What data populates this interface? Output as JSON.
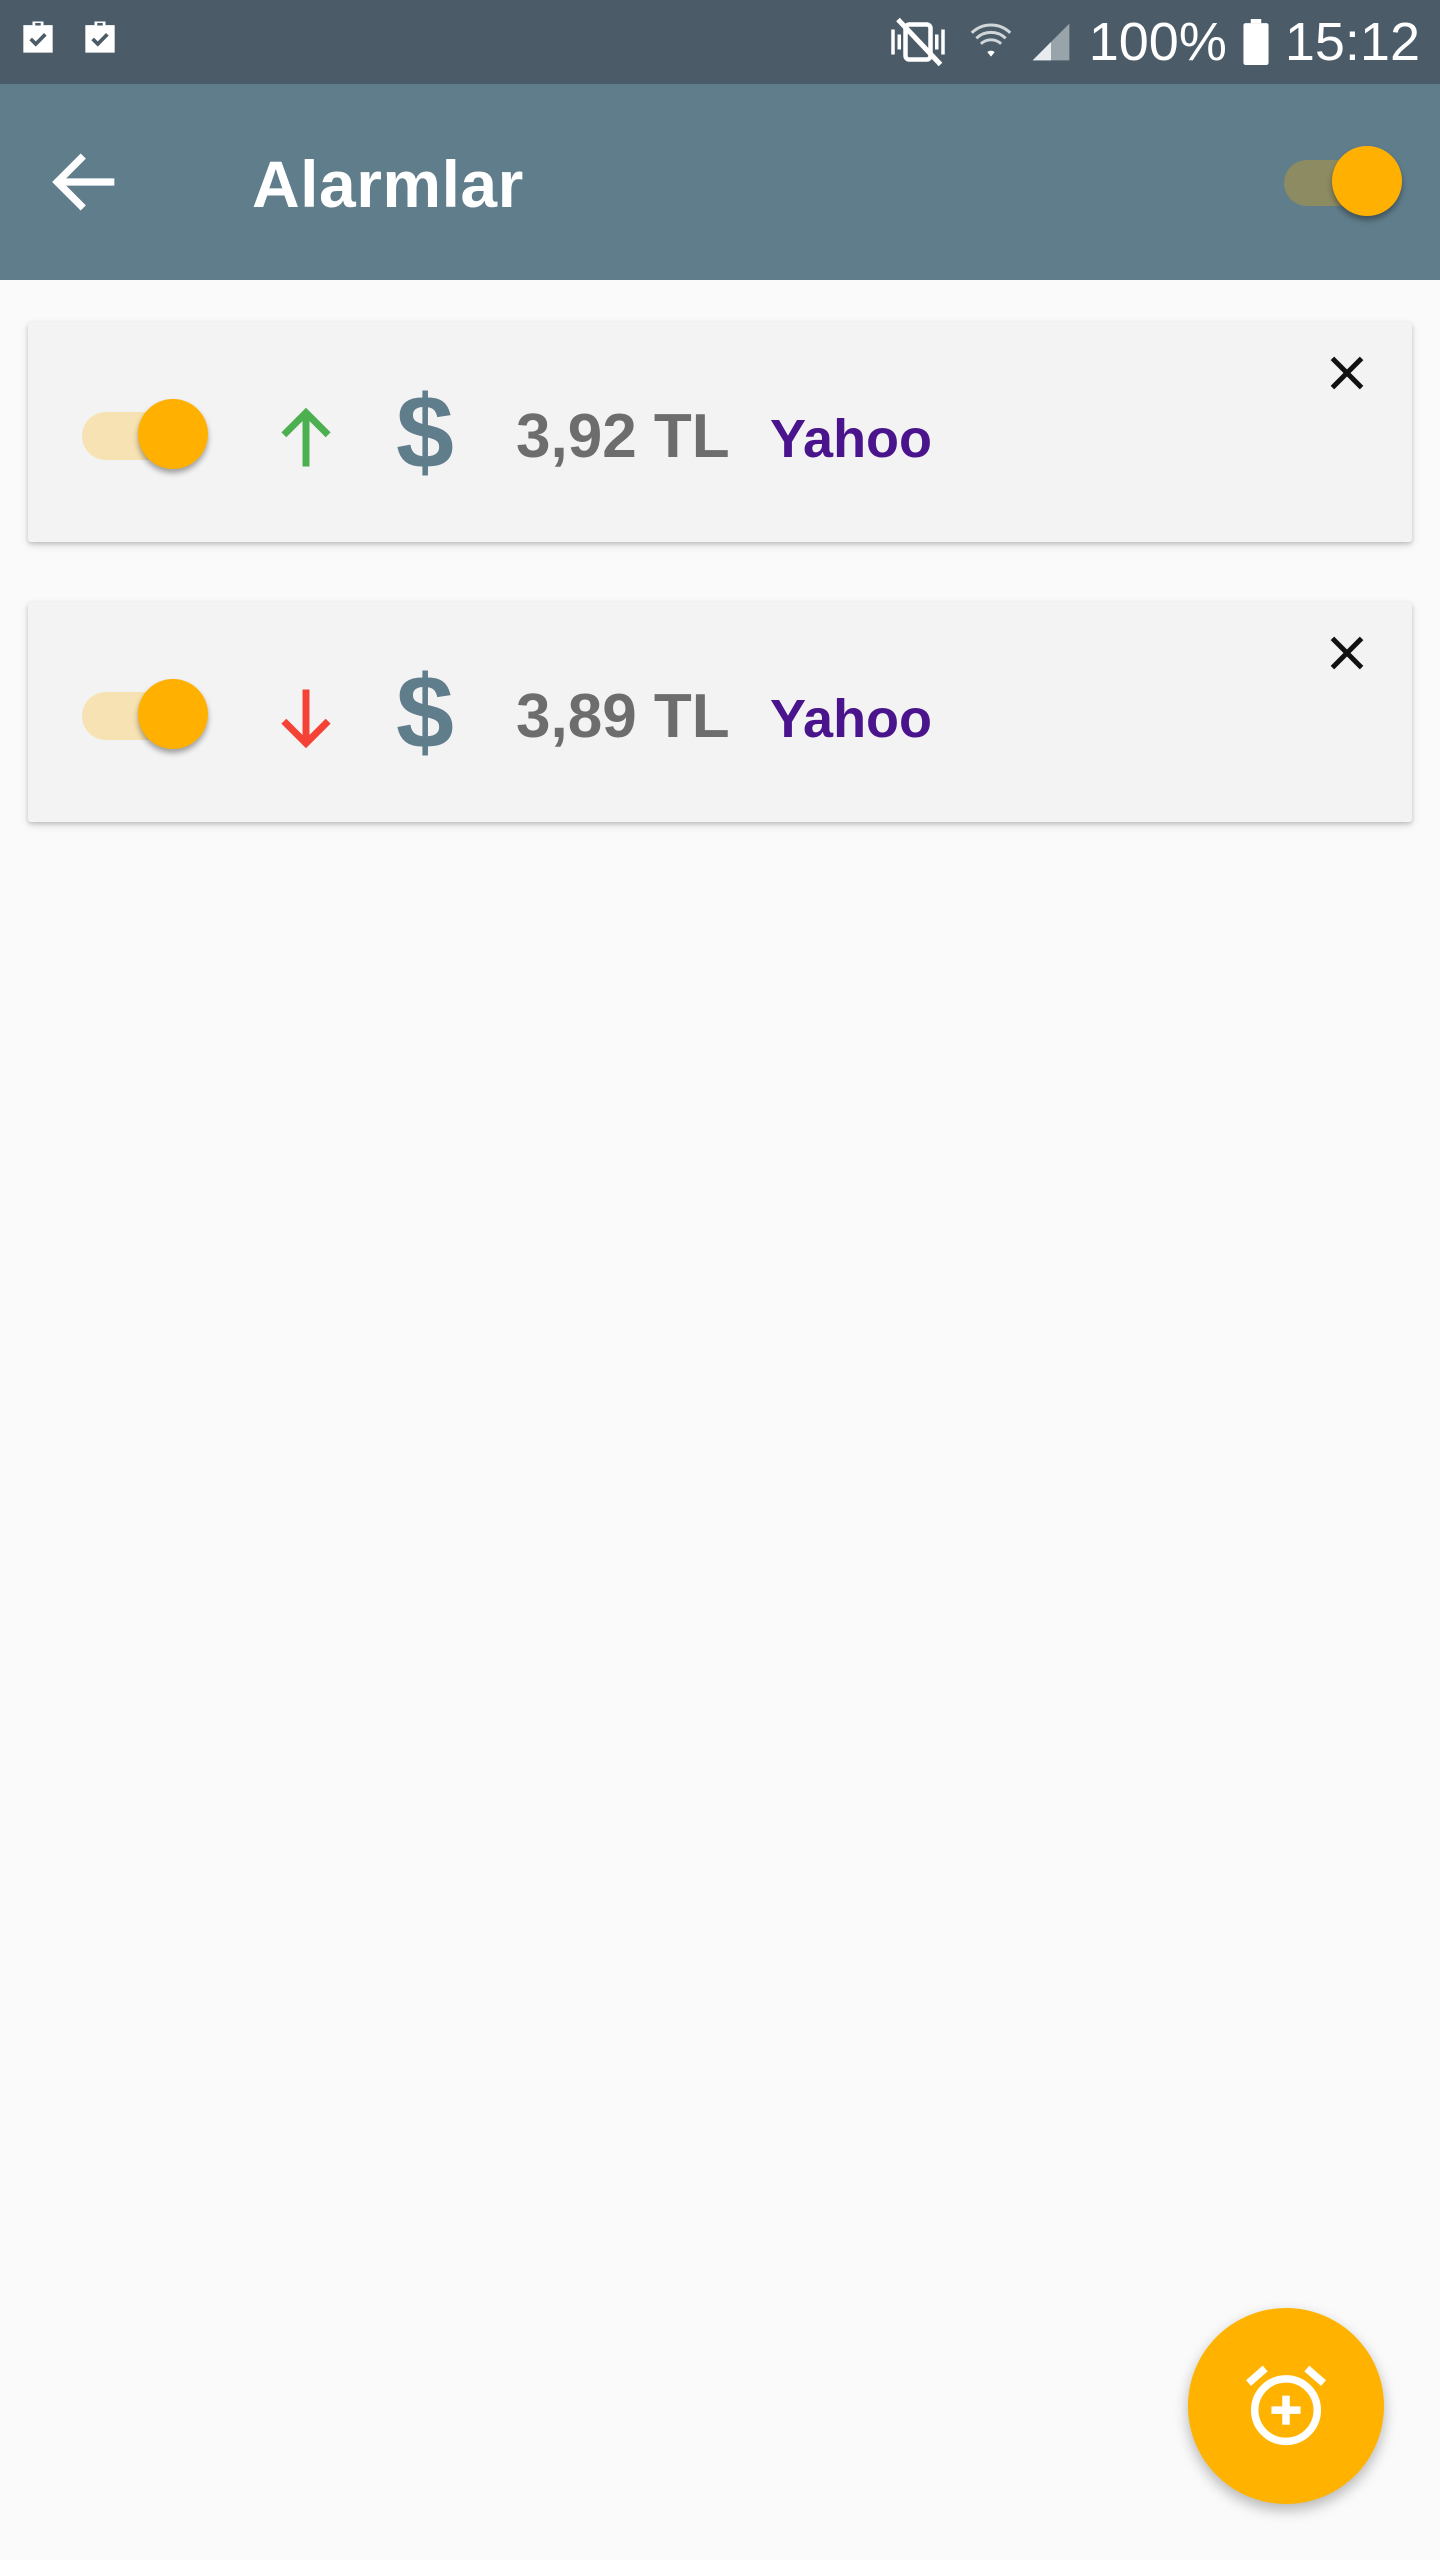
{
  "status_bar": {
    "battery": "100%",
    "time": "15:12",
    "left_icons": [
      "briefcase-check-icon",
      "briefcase-check-icon"
    ],
    "right_icons": [
      "vibrate-mute-icon",
      "wifi-icon",
      "signal-icon",
      "battery-icon"
    ]
  },
  "app_bar": {
    "title": "Alarmlar",
    "back_icon": "arrow-back-icon",
    "master_switch_on": true
  },
  "alarms": [
    {
      "enabled": true,
      "direction": "up",
      "direction_icon": "arrow-up-icon",
      "direction_color": "#4caf50",
      "currency_symbol": "$",
      "price": "3,92 TL",
      "source": "Yahoo",
      "close_icon": "close-icon"
    },
    {
      "enabled": true,
      "direction": "down",
      "direction_icon": "arrow-down-icon",
      "direction_color": "#f44336",
      "currency_symbol": "$",
      "price": "3,89 TL",
      "source": "Yahoo",
      "close_icon": "close-icon"
    }
  ],
  "fab": {
    "icon": "add-alarm-icon"
  },
  "colors": {
    "status_bar": "#4b5c68",
    "app_bar": "#607d8b",
    "accent": "#ffb000",
    "source_text": "#4a148c",
    "price_text": "#6d6d6d"
  }
}
